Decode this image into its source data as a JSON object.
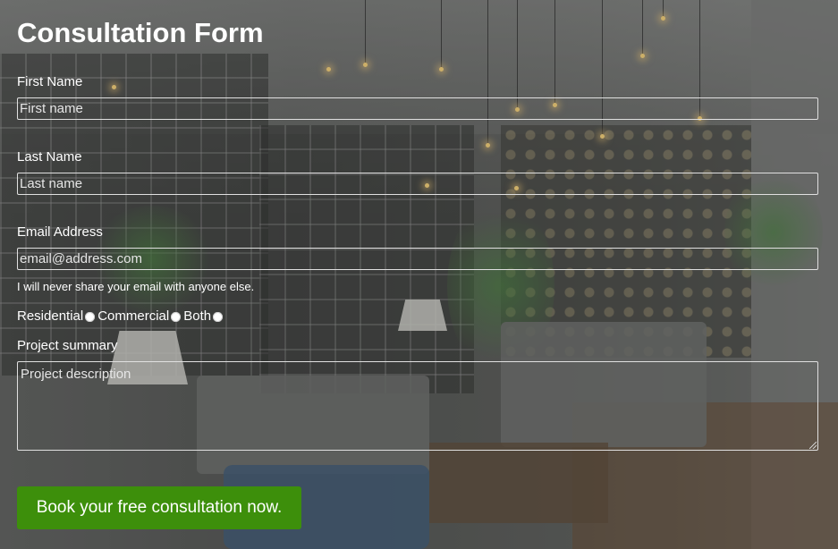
{
  "form": {
    "title": "Consultation Form",
    "first_name": {
      "label": "First Name",
      "placeholder": "First name"
    },
    "last_name": {
      "label": "Last Name",
      "placeholder": "Last name"
    },
    "email": {
      "label": "Email Address",
      "placeholder": "email@address.com",
      "help": "I will never share your email with anyone else."
    },
    "project_type": {
      "options": [
        "Residential",
        "Commercial",
        "Both"
      ]
    },
    "summary": {
      "label": "Project summary",
      "placeholder": "Project description"
    },
    "submit": {
      "label": "Book your free consultation now.",
      "color": "#3d8f0b"
    }
  }
}
